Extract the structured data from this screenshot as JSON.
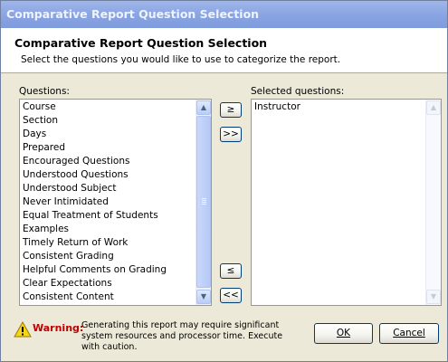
{
  "window": {
    "title": "Comparative Report Question Selection"
  },
  "header": {
    "title": "Comparative Report Question Selection",
    "subtitle": "Select the questions you would like to use to categorize the report."
  },
  "questions": {
    "label": "Questions:",
    "items": [
      "Course",
      "Section",
      "Days",
      "Prepared",
      "Encouraged Questions",
      "Understood Questions",
      "Understood Subject",
      "Never Intimidated",
      "Equal Treatment of Students",
      "Examples",
      "Timely Return of Work",
      "Consistent Grading",
      "Helpful Comments on Grading",
      "Clear Expectations",
      "Consistent Content"
    ]
  },
  "selected": {
    "label": "Selected questions:",
    "items": [
      "Instructor"
    ]
  },
  "transfer_buttons": {
    "add_one": "≥",
    "add_all": ">>",
    "remove_one": "≤",
    "remove_all": "<<"
  },
  "warning": {
    "label": "Warning:",
    "text": "Generating this report may require significant system resources and processor time. Execute with caution."
  },
  "buttons": {
    "ok": "OK",
    "cancel": "Cancel"
  },
  "colors": {
    "warning": "#c00000",
    "titlebar": "#8aa5e3",
    "border": "#7f9db9"
  },
  "icons": {
    "warning": "warning-triangle-icon"
  }
}
